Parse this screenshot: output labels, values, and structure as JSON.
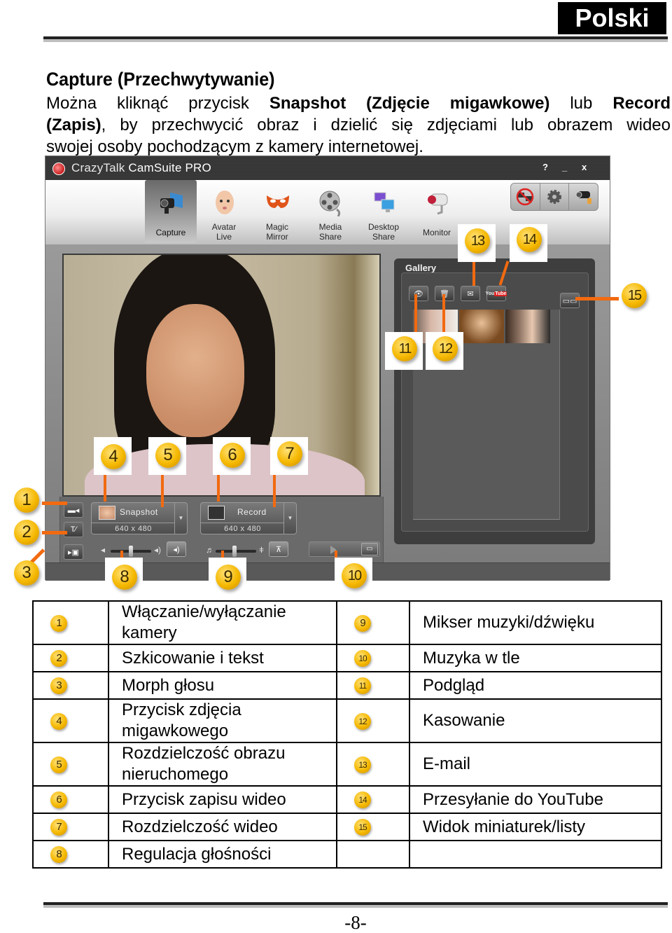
{
  "header": {
    "language": "Polski"
  },
  "section": {
    "title": "Capture (Przechwytywanie)",
    "intro": {
      "line1_a": "Można kliknąć przycisk ",
      "line1_b": "Snapshot (Zdjęcie migawkowe)",
      "line1_c": " lub ",
      "line1_d": "Record",
      "line2_a": "(Zapis)",
      "line2_b": ", by przechwycić obraz i dzielić się zdjęciami lub obrazem wideo",
      "line3": "swojej osoby pochodzącym z kamery internetowej."
    }
  },
  "app": {
    "title_a": "CrazyTalk ",
    "title_b": "CamSuite PRO",
    "window_buttons": {
      "help": "?",
      "minimize": "_",
      "close": "x"
    },
    "modes": [
      {
        "label": "Capture",
        "icon": "webcam-icon",
        "active": true
      },
      {
        "label": "Avatar\nLive",
        "icon": "baby-face-icon",
        "active": false
      },
      {
        "label": "Magic\nMirror",
        "icon": "mask-icon",
        "active": false
      },
      {
        "label": "Media\nShare",
        "icon": "film-reel-icon",
        "active": false
      },
      {
        "label": "Desktop\nShare",
        "icon": "monitors-icon",
        "active": false
      },
      {
        "label": "Monitor",
        "icon": "security-camera-icon",
        "active": false
      }
    ],
    "tools": [
      "no-remote-icon",
      "gear-icon",
      "camera-settings-icon"
    ],
    "capture": {
      "snapshot_label": "Snapshot",
      "snapshot_resolution": "640 x 480",
      "record_label": "Record",
      "record_resolution": "640 x 480"
    },
    "gallery": {
      "title": "Gallery",
      "buttons": [
        "preview-icon",
        "trash-icon",
        "email-icon",
        "youtube-icon"
      ],
      "youtube_text_a": "You",
      "youtube_text_b": "Tube",
      "thumbnail_count": 3
    }
  },
  "callouts": [
    "1",
    "2",
    "3",
    "4",
    "5",
    "6",
    "7",
    "8",
    "9",
    "10",
    "11",
    "12",
    "13",
    "14",
    "15"
  ],
  "legend": {
    "rows": [
      {
        "left_num": "1",
        "left_label": "Włączanie/wyłączanie kamery",
        "right_num": "9",
        "right_label": "Mikser muzyki/dźwięku"
      },
      {
        "left_num": "2",
        "left_label": "Szkicowanie i tekst",
        "right_num": "10",
        "right_label": "Muzyka w tle"
      },
      {
        "left_num": "3",
        "left_label": "Morph głosu",
        "right_num": "11",
        "right_label": "Podgląd"
      },
      {
        "left_num": "4",
        "left_label": "Przycisk zdjęcia migawkowego",
        "right_num": "12",
        "right_label": "Kasowanie"
      },
      {
        "left_num": "5",
        "left_label": "Rozdzielczość obrazu nieruchomego",
        "right_num": "13",
        "right_label": "E-mail"
      },
      {
        "left_num": "6",
        "left_label": "Przycisk zapisu wideo",
        "right_num": "14",
        "right_label": "Przesyłanie do YouTube"
      },
      {
        "left_num": "7",
        "left_label": "Rozdzielczość wideo",
        "right_num": "15",
        "right_label": "Widok miniaturek/listy"
      },
      {
        "left_num": "8",
        "left_label": "Regulacja głośności",
        "right_num": "",
        "right_label": ""
      }
    ]
  },
  "footer": {
    "page_number": "-8-"
  }
}
